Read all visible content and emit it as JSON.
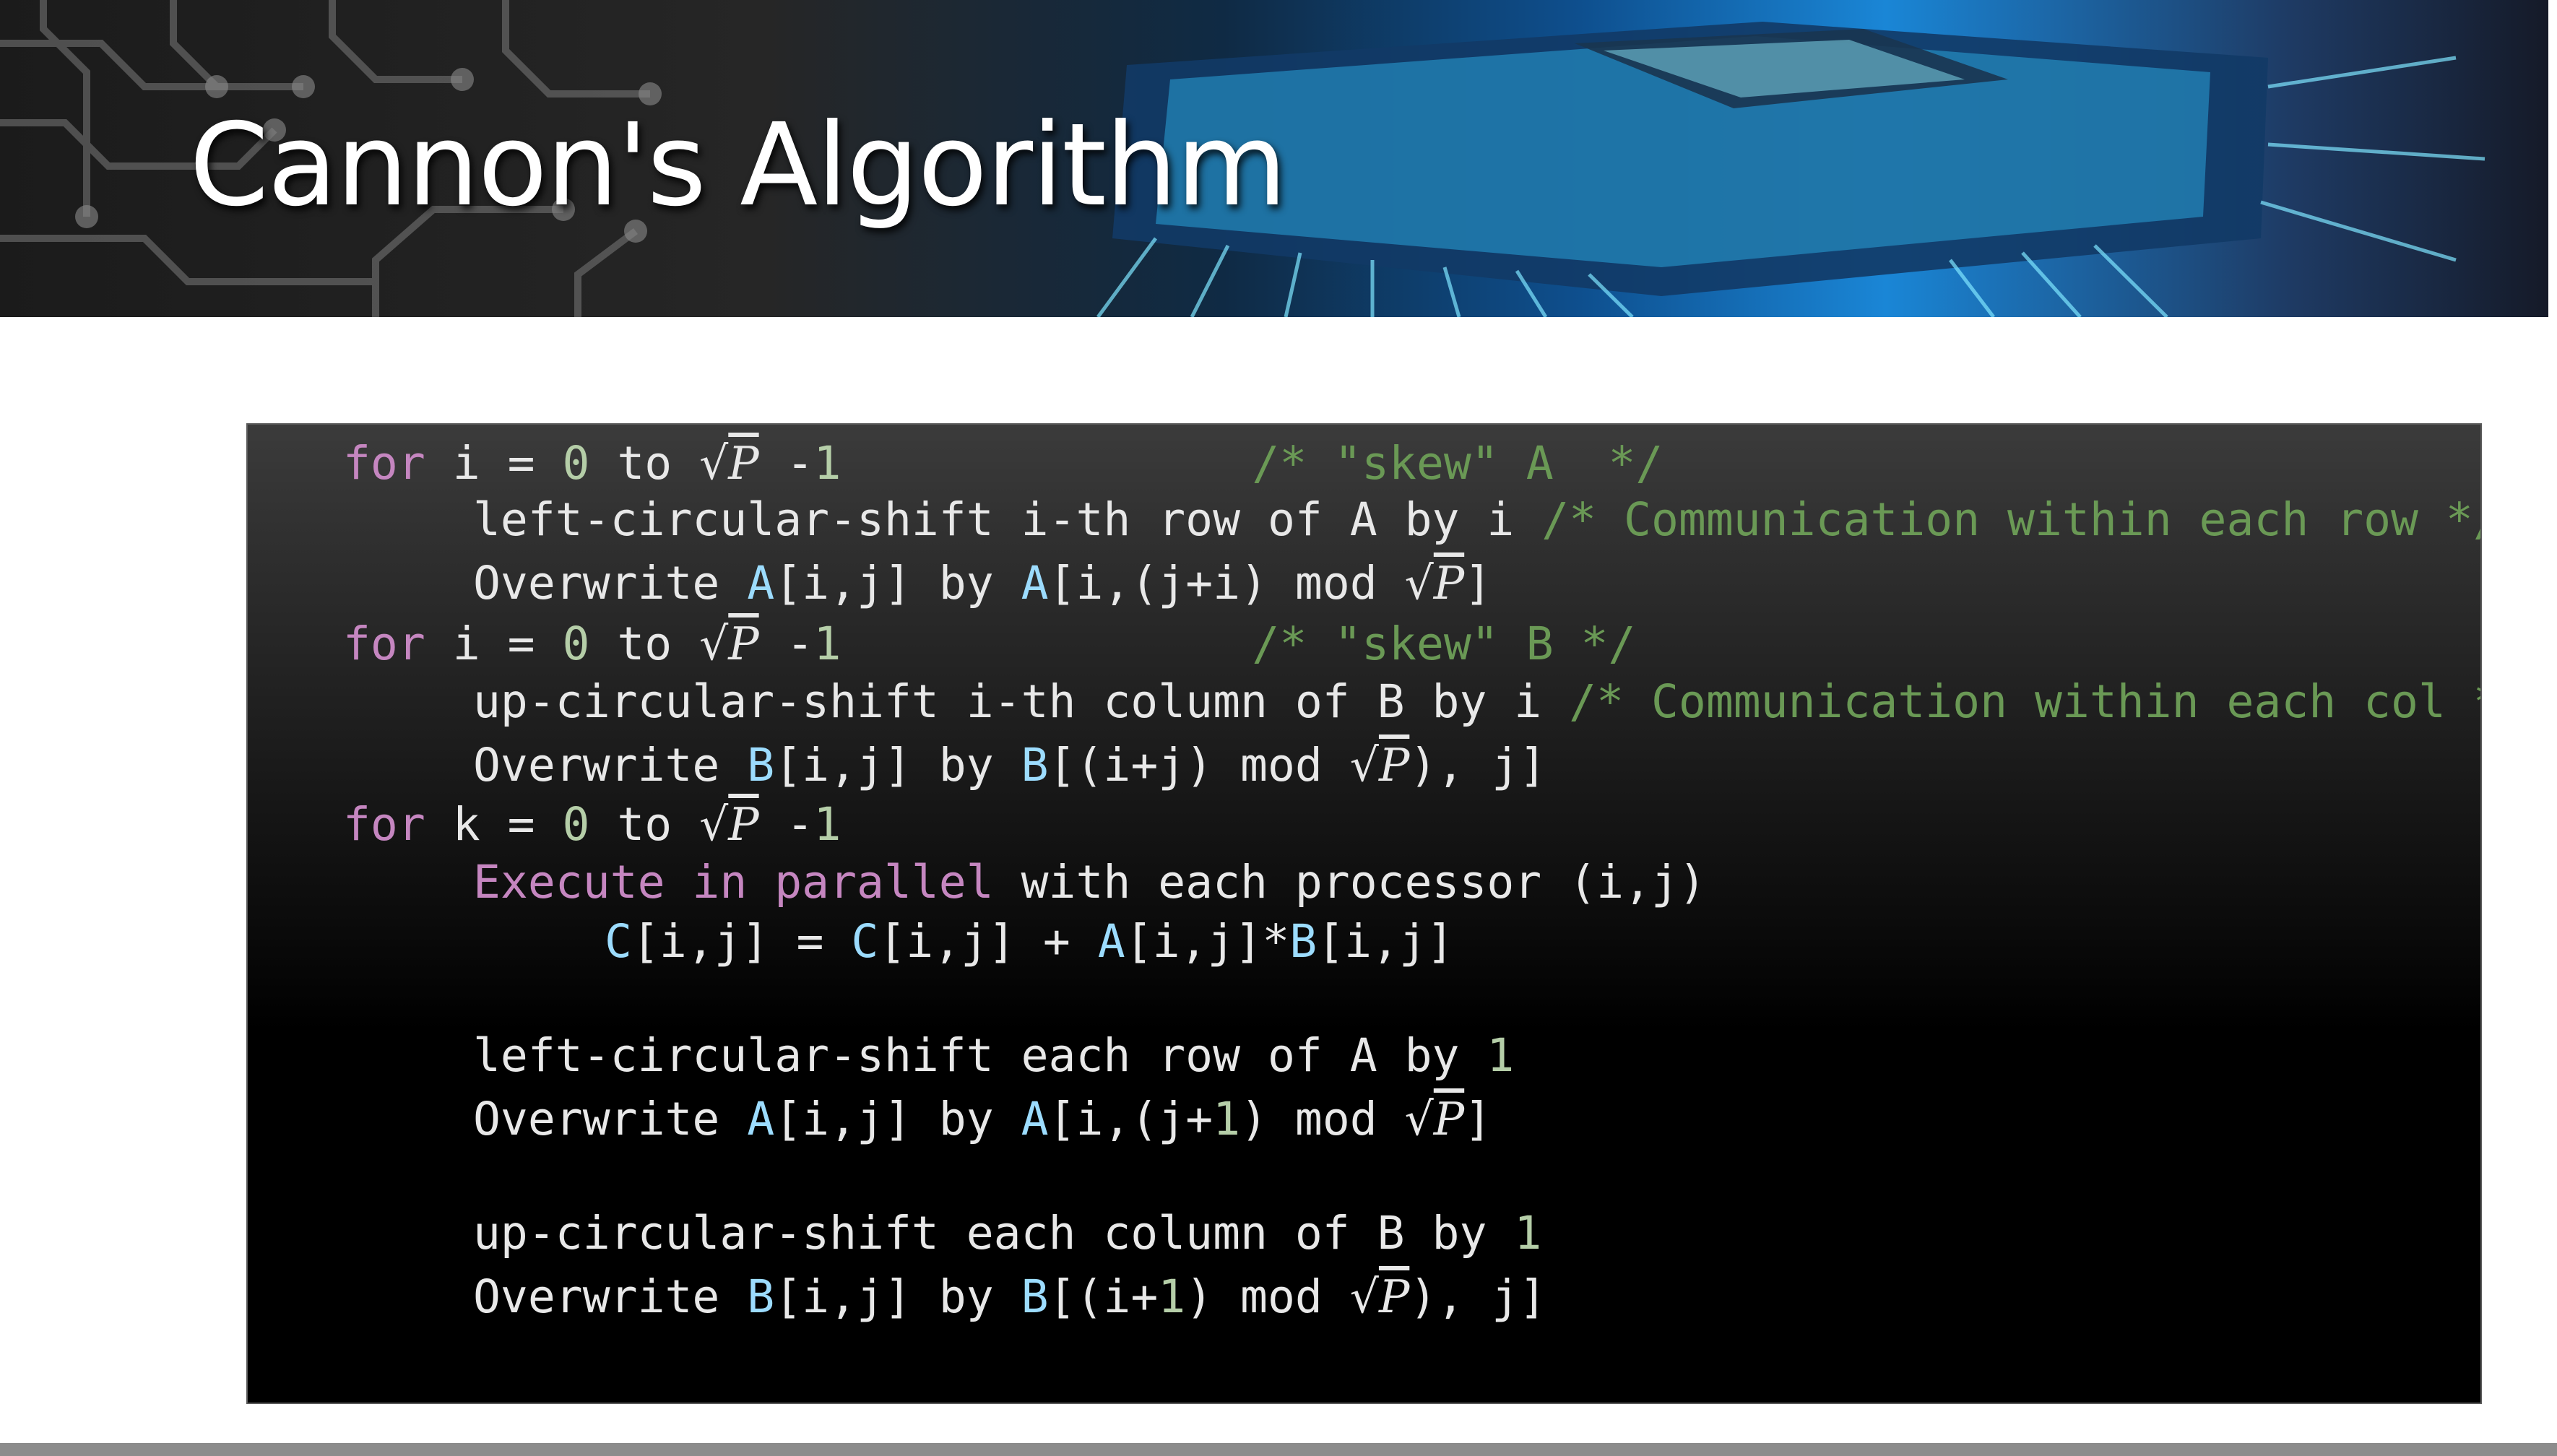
{
  "slide": {
    "title": "Cannon's Algorithm"
  },
  "banner": {
    "image_icon": "circuit-board-chip-image"
  },
  "code": {
    "lines": [
      {
        "indent": 0,
        "parts": [
          [
            "kw",
            "for"
          ],
          [
            "txt",
            " i = "
          ],
          [
            "num",
            "0"
          ],
          [
            "txt",
            " to "
          ],
          [
            "sqrt",
            "P"
          ],
          [
            "txt",
            " -"
          ],
          [
            "num",
            "1"
          ],
          [
            "txt",
            "               "
          ],
          [
            "cm",
            "/* \"skew\" A  */"
          ]
        ]
      },
      {
        "indent": 1,
        "parts": [
          [
            "txt",
            "left-circular-shift i-th row of A by i "
          ],
          [
            "cm",
            "/* Communication within each row */"
          ]
        ]
      },
      {
        "indent": 1,
        "parts": [
          [
            "txt",
            "Overwrite "
          ],
          [
            "var",
            "A"
          ],
          [
            "txt",
            "[i,j] by "
          ],
          [
            "var",
            "A"
          ],
          [
            "txt",
            "[i,(j+i) mod "
          ],
          [
            "sqrt",
            "P"
          ],
          [
            "txt",
            "]"
          ]
        ]
      },
      {
        "indent": 0,
        "parts": [
          [
            "kw",
            "for"
          ],
          [
            "txt",
            " i = "
          ],
          [
            "num",
            "0"
          ],
          [
            "txt",
            " to "
          ],
          [
            "sqrt",
            "P"
          ],
          [
            "txt",
            " -"
          ],
          [
            "num",
            "1"
          ],
          [
            "txt",
            "               "
          ],
          [
            "cm",
            "/* \"skew\" B */"
          ]
        ]
      },
      {
        "indent": 1,
        "parts": [
          [
            "txt",
            "up-circular-shift i-th column of B by i "
          ],
          [
            "cm",
            "/* Communication within each col */"
          ]
        ]
      },
      {
        "indent": 1,
        "parts": [
          [
            "txt",
            "Overwrite "
          ],
          [
            "var",
            "B"
          ],
          [
            "txt",
            "[i,j] by "
          ],
          [
            "var",
            "B"
          ],
          [
            "txt",
            "[(i+j) mod "
          ],
          [
            "sqrt",
            "P"
          ],
          [
            "txt",
            "), j]"
          ]
        ]
      },
      {
        "indent": 0,
        "parts": [
          [
            "kw",
            "for"
          ],
          [
            "txt",
            " k = "
          ],
          [
            "num",
            "0"
          ],
          [
            "txt",
            " to "
          ],
          [
            "sqrt",
            "P"
          ],
          [
            "txt",
            " -"
          ],
          [
            "num",
            "1"
          ]
        ]
      },
      {
        "indent": 1,
        "parts": [
          [
            "kw",
            "Execute in parallel"
          ],
          [
            "txt",
            " with each processor (i,j)"
          ]
        ]
      },
      {
        "indent": 2,
        "parts": [
          [
            "var",
            "C"
          ],
          [
            "txt",
            "[i,j] = "
          ],
          [
            "var",
            "C"
          ],
          [
            "txt",
            "[i,j] + "
          ],
          [
            "var",
            "A"
          ],
          [
            "txt",
            "[i,j]*"
          ],
          [
            "var",
            "B"
          ],
          [
            "txt",
            "[i,j]"
          ]
        ]
      },
      {
        "indent": 1,
        "parts": [
          [
            "txt",
            "left-circular-shift each row of A by "
          ],
          [
            "num",
            "1"
          ]
        ]
      },
      {
        "indent": 1,
        "parts": [
          [
            "txt",
            "Overwrite "
          ],
          [
            "var",
            "A"
          ],
          [
            "txt",
            "[i,j] by "
          ],
          [
            "var",
            "A"
          ],
          [
            "txt",
            "[i,(j+"
          ],
          [
            "num",
            "1"
          ],
          [
            "txt",
            ") mod "
          ],
          [
            "sqrt",
            "P"
          ],
          [
            "txt",
            "]"
          ]
        ]
      },
      {
        "indent": 1,
        "parts": [
          [
            "txt",
            "up-circular-shift each column of B by "
          ],
          [
            "num",
            "1"
          ]
        ]
      },
      {
        "indent": 1,
        "parts": [
          [
            "txt",
            "Overwrite "
          ],
          [
            "var",
            "B"
          ],
          [
            "txt",
            "[i,j] by "
          ],
          [
            "var",
            "B"
          ],
          [
            "txt",
            "[(i+"
          ],
          [
            "num",
            "1"
          ],
          [
            "txt",
            ") mod "
          ],
          [
            "sqrt",
            "P"
          ],
          [
            "txt",
            "), j]"
          ]
        ]
      }
    ]
  }
}
